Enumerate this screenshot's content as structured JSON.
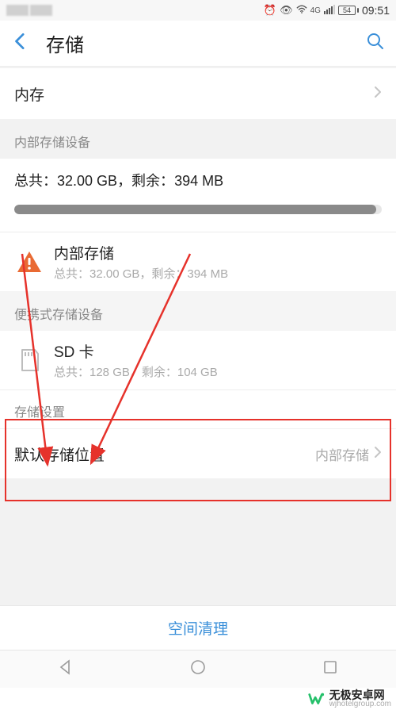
{
  "status": {
    "battery_percent": "54",
    "time": "09:51",
    "network_label": "4G"
  },
  "header": {
    "title": "存储"
  },
  "memory": {
    "label": "内存"
  },
  "internal_section": {
    "header": "内部存储设备",
    "summary_prefix": "总共：",
    "summary_total": "32.00 GB",
    "summary_sep": "，剩余：",
    "summary_free": "394 MB",
    "item": {
      "name": "内部存储",
      "sub": "总共：32.00 GB，剩余：394 MB"
    }
  },
  "portable_section": {
    "header": "便携式存储设备",
    "item": {
      "name": "SD 卡",
      "sub": "总共：128 GB，剩余：104 GB"
    }
  },
  "storage_settings": {
    "header": "存储设置",
    "default_location": {
      "label": "默认存储位置",
      "value": "内部存储"
    }
  },
  "footer": {
    "clean": "空间清理"
  },
  "watermark": {
    "brand": "无极安卓网",
    "url": "wjhotelgroup.com"
  }
}
